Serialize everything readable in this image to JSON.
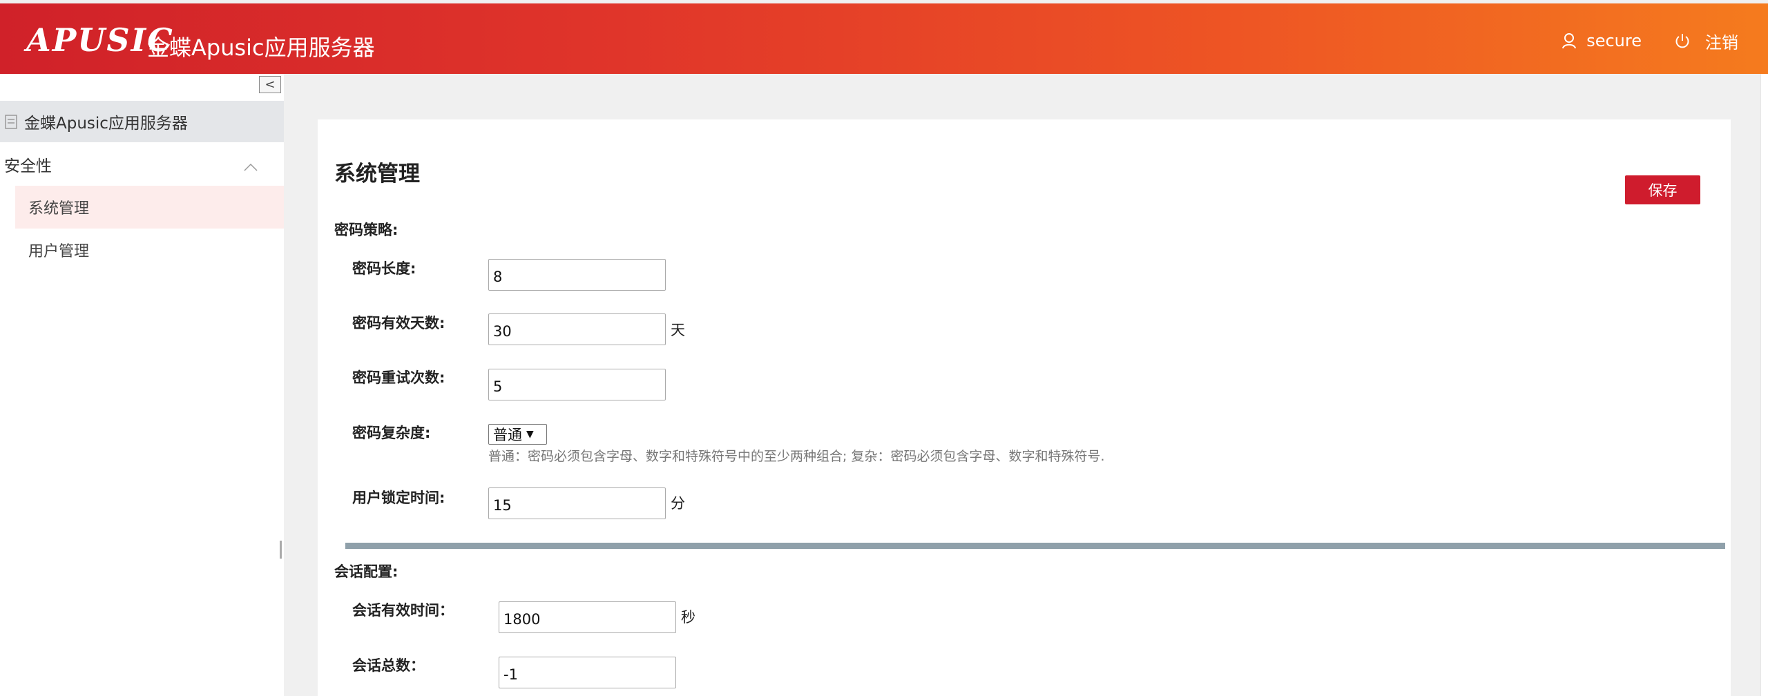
{
  "header": {
    "logo_text": "APUSIC",
    "app_title": "金蝶Apusic应用服务器",
    "username": "secure",
    "logout_label": "注销",
    "gradient_start": "#d02129",
    "gradient_end": "#f57b1e"
  },
  "sidebar": {
    "collapse_symbol": "<",
    "server_label": "金蝶Apusic应用服务器",
    "group_label": "安全性",
    "items": [
      {
        "label": "系统管理",
        "active": true
      },
      {
        "label": "用户管理",
        "active": false
      }
    ]
  },
  "main": {
    "title": "系统管理",
    "save_label": "保存",
    "password_section": {
      "title": "密码策略:",
      "length_label": "密码长度:",
      "length_value": "8",
      "valid_days_label": "密码有效天数:",
      "valid_days_value": "30",
      "valid_days_unit": "天",
      "retry_label": "密码重试次数:",
      "retry_value": "5",
      "complexity_label": "密码复杂度:",
      "complexity_value": "普通",
      "complexity_hint": "普通：密码必须包含字母、数字和特殊符号中的至少两种组合; 复杂：密码必须包含字母、数字和特殊符号.",
      "lock_label": "用户锁定时间:",
      "lock_value": "15",
      "lock_unit": "分"
    },
    "session_section": {
      "title": "会话配置:",
      "timeout_label": "会话有效时间：",
      "timeout_value": "1800",
      "timeout_unit": "秒",
      "total_label": "会话总数：",
      "total_value": "-1"
    }
  },
  "colors": {
    "accent": "#cf1c2d",
    "active_nav_bg": "#fdeceb",
    "divider": "#8fa0aa"
  }
}
